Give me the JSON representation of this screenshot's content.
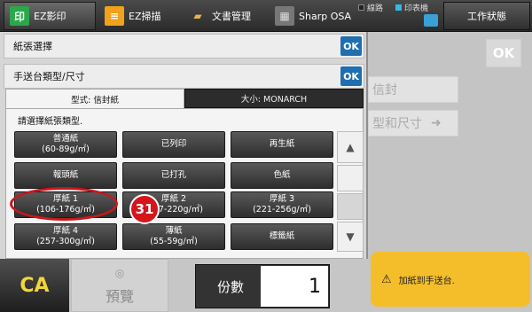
{
  "topbar": {
    "modes": [
      {
        "label": "EZ影印",
        "icon": "copy-icon",
        "icon_glyph": "印"
      },
      {
        "label": "EZ掃描",
        "icon": "scan-icon",
        "icon_glyph": "≡"
      },
      {
        "label": "文書管理",
        "icon": "folder-icon",
        "icon_glyph": "▰"
      },
      {
        "label": "Sharp OSA",
        "icon": "osa-icon",
        "icon_glyph": "▦"
      }
    ],
    "status": {
      "line": "線路",
      "printer": "印表機"
    },
    "job_status": "工作狀態"
  },
  "dialog": {
    "paper_select_title": "紙張選擇",
    "bypass_title": "手送台類型/尺寸",
    "ok_label": "OK",
    "tabs": {
      "type": "型式: 信封紙",
      "size": "大小: MONARCH"
    },
    "prompt": "請選擇紙張類型.",
    "paper_types": [
      {
        "line1": "普通紙",
        "line2": "(60-89g/㎡)"
      },
      {
        "line1": "已列印",
        "line2": ""
      },
      {
        "line1": "再生紙",
        "line2": ""
      },
      {
        "line1": "報頭紙",
        "line2": ""
      },
      {
        "line1": "已打孔",
        "line2": ""
      },
      {
        "line1": "色紙",
        "line2": ""
      },
      {
        "line1": "厚紙 1",
        "line2": "(106-176g/㎡)"
      },
      {
        "line1": "厚紙 2",
        "line2": "(177-220g/㎡)"
      },
      {
        "line1": "厚紙 3",
        "line2": "(221-256g/㎡)"
      },
      {
        "line1": "厚紙 4",
        "line2": "(257-300g/㎡)"
      },
      {
        "line1": "薄紙",
        "line2": "(55-59g/㎡)"
      },
      {
        "line1": "標籤紙",
        "line2": ""
      }
    ],
    "callout_number": "31"
  },
  "background": {
    "ok_label": "OK",
    "btn1": "信封",
    "btn2": "型和尺寸"
  },
  "bottom": {
    "ca": "CA",
    "preview": "預覽",
    "copies_label": "份數",
    "copies_value": "1",
    "alert": "加紙到手送台."
  },
  "colors": {
    "ok_blue": "#1f6fb0",
    "ca_yellow": "#f2d63a",
    "alert_yellow": "#f4be2b",
    "callout_red": "#c8171e"
  }
}
